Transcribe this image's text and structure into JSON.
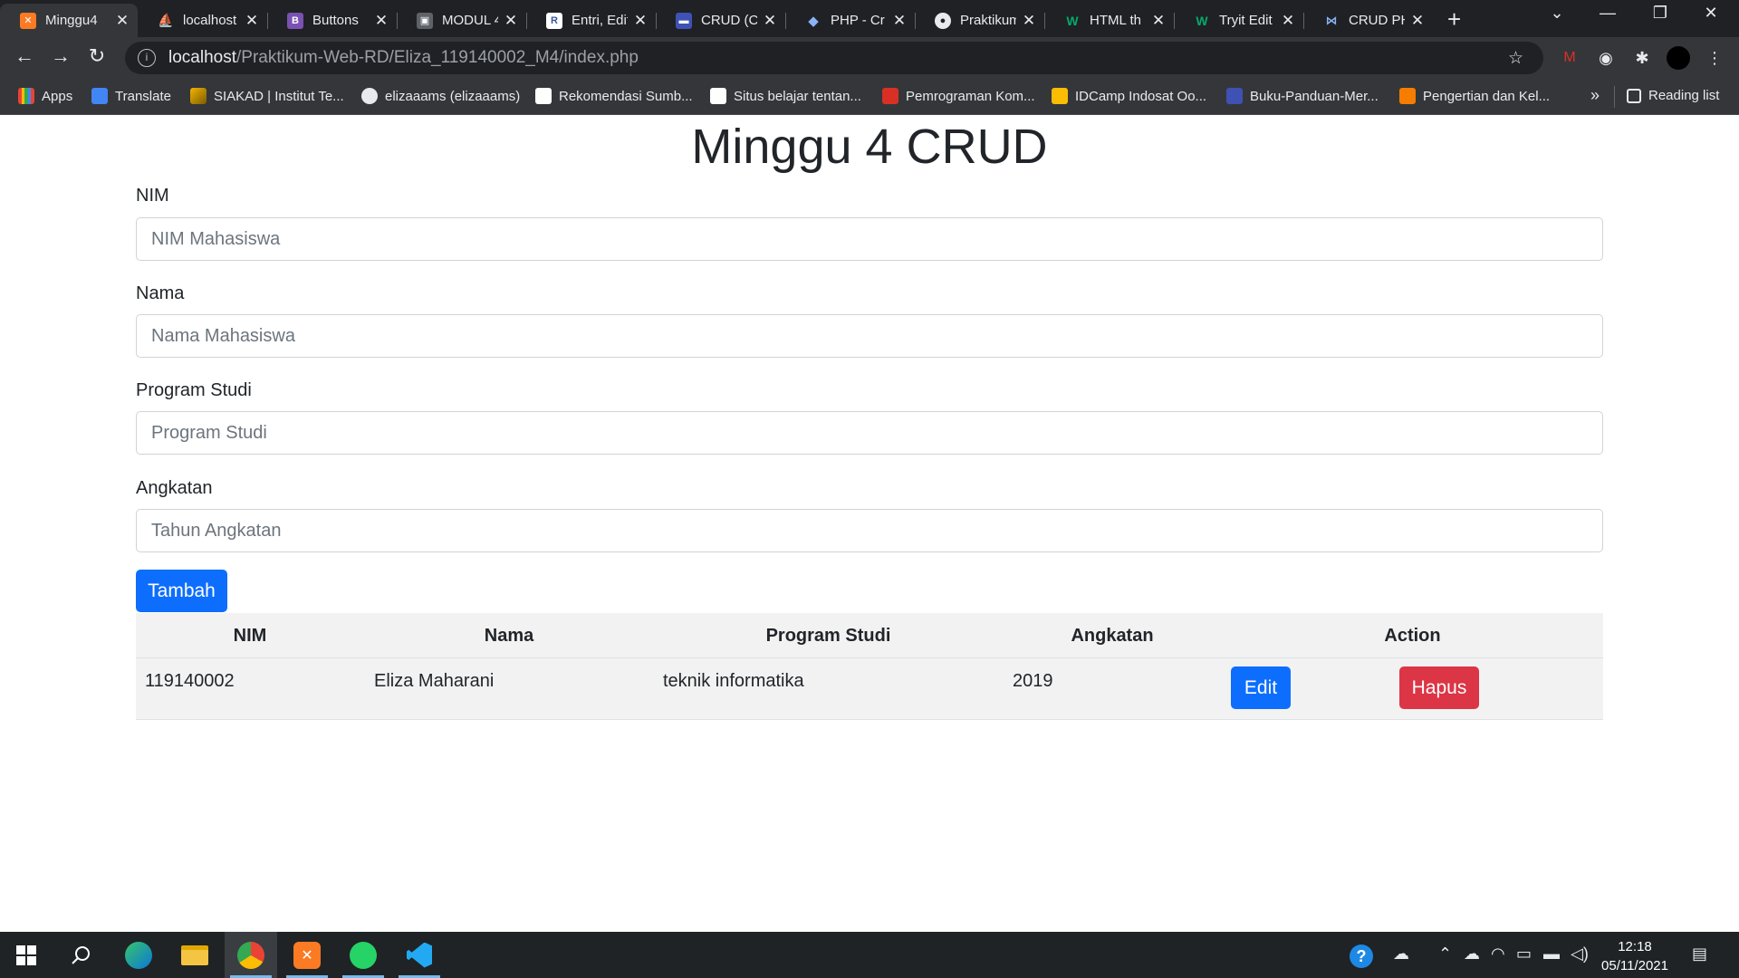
{
  "tabs": [
    {
      "title": "Minggu4",
      "icon": "xampp-icon",
      "color": "#fb7a24",
      "active": true
    },
    {
      "title": "localhost",
      "icon": "phpmyadmin-icon",
      "color": "#f89c0e"
    },
    {
      "title": "Buttons",
      "icon": "bootstrap-icon",
      "color": "#7952b3"
    },
    {
      "title": "MODUL 4",
      "icon": "classroom-icon",
      "color": "#9aa0a6"
    },
    {
      "title": "Entri, Edit",
      "icon": "doc-icon",
      "color": "#3b5998"
    },
    {
      "title": "CRUD (Cr",
      "icon": "site-icon",
      "color": "#3f51b5"
    },
    {
      "title": "PHP - Cr",
      "icon": "php-icon",
      "color": "#4f5b93"
    },
    {
      "title": "Praktikum",
      "icon": "github-icon",
      "color": "#e8eaed"
    },
    {
      "title": "HTML th",
      "icon": "w3schools-icon",
      "color": "#04aa6d"
    },
    {
      "title": "Tryit Edit",
      "icon": "w3schools-icon",
      "color": "#04aa6d"
    },
    {
      "title": "CRUD PH",
      "icon": "code-icon",
      "color": "#8ab4f8"
    }
  ],
  "tab_close": "✕",
  "new_tab": "+",
  "address": {
    "host": "localhost",
    "path": "/Praktikum-Web-RD/Eliza_119140002_M4/index.php"
  },
  "bookmarks": [
    {
      "label": "Apps",
      "icon": "apps-grid-icon",
      "color": "#ea4335"
    },
    {
      "label": "Translate",
      "icon": "translate-icon",
      "color": "#4285f4"
    },
    {
      "label": "SIAKAD | Institut Te...",
      "icon": "siakad-icon",
      "color": "#f4b400"
    },
    {
      "label": "elizaaams (elizaaams)",
      "icon": "github-icon",
      "color": "#e8eaed"
    },
    {
      "label": "Rekomendasi Sumb...",
      "icon": "medium-icon",
      "color": "#ffffff"
    },
    {
      "label": "Situs belajar tentan...",
      "icon": "medium-icon",
      "color": "#ffffff"
    },
    {
      "label": "Pemrograman Kom...",
      "icon": "site-icon",
      "color": "#d93025"
    },
    {
      "label": "IDCamp Indosat Oo...",
      "icon": "idcamp-icon",
      "color": "#fbbc04"
    },
    {
      "label": "Buku-Panduan-Mer...",
      "icon": "doc-icon",
      "color": "#3f51b5"
    },
    {
      "label": "Pengertian dan Kel...",
      "icon": "blogger-icon",
      "color": "#f57d00"
    }
  ],
  "bookmarks_more": "»",
  "reading_list": "Reading list",
  "page": {
    "title": "Minggu 4 CRUD",
    "form": {
      "nim_label": "NIM",
      "nim_placeholder": "NIM Mahasiswa",
      "nama_label": "Nama",
      "nama_placeholder": "Nama Mahasiswa",
      "prodi_label": "Program Studi",
      "prodi_placeholder": "Program Studi",
      "angkatan_label": "Angkatan",
      "angkatan_placeholder": "Tahun Angkatan",
      "submit_label": "Tambah"
    },
    "table": {
      "headers": [
        "NIM",
        "Nama",
        "Program Studi",
        "Angkatan",
        "Action"
      ],
      "rows": [
        {
          "nim": "119140002",
          "nama": "Eliza Maharani",
          "prodi": "teknik informatika",
          "angkatan": "2019",
          "edit_label": "Edit",
          "delete_label": "Hapus"
        }
      ]
    }
  },
  "taskbar": {
    "clock_time": "12:18",
    "clock_date": "05/11/2021"
  },
  "colors": {
    "primary": "#0d6efd",
    "danger": "#dc3545",
    "chrome_dark": "#202124",
    "chrome_toolbar": "#35363a"
  }
}
